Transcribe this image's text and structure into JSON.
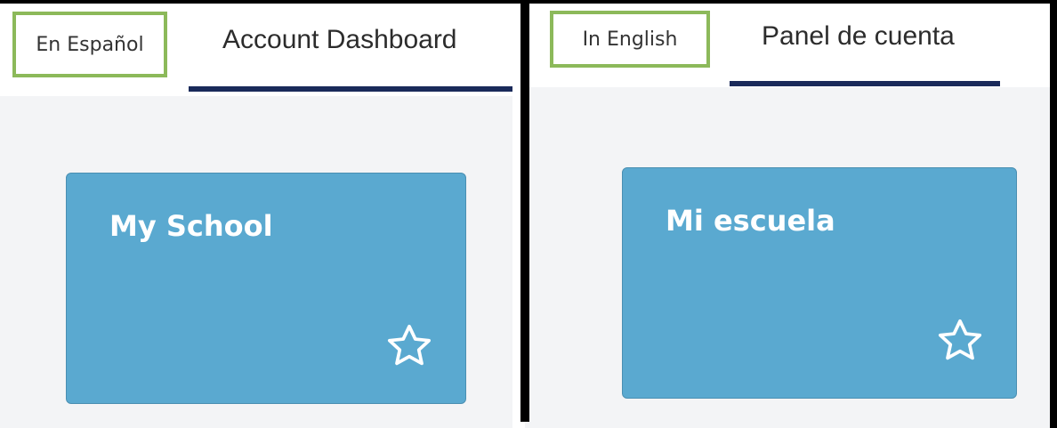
{
  "panels": [
    {
      "lang_toggle": "En Español",
      "tab": "Account Dashboard",
      "card_title": "My School"
    },
    {
      "lang_toggle": "In English",
      "tab": "Panel de cuenta",
      "card_title": "Mi escuela"
    }
  ],
  "icons": {
    "favorite": "star-outline-icon"
  },
  "colors": {
    "toggle_border": "#8cb95a",
    "tab_underline": "#1a2a5a",
    "card": "#5aa9d0",
    "content_bg": "#f3f4f6"
  }
}
